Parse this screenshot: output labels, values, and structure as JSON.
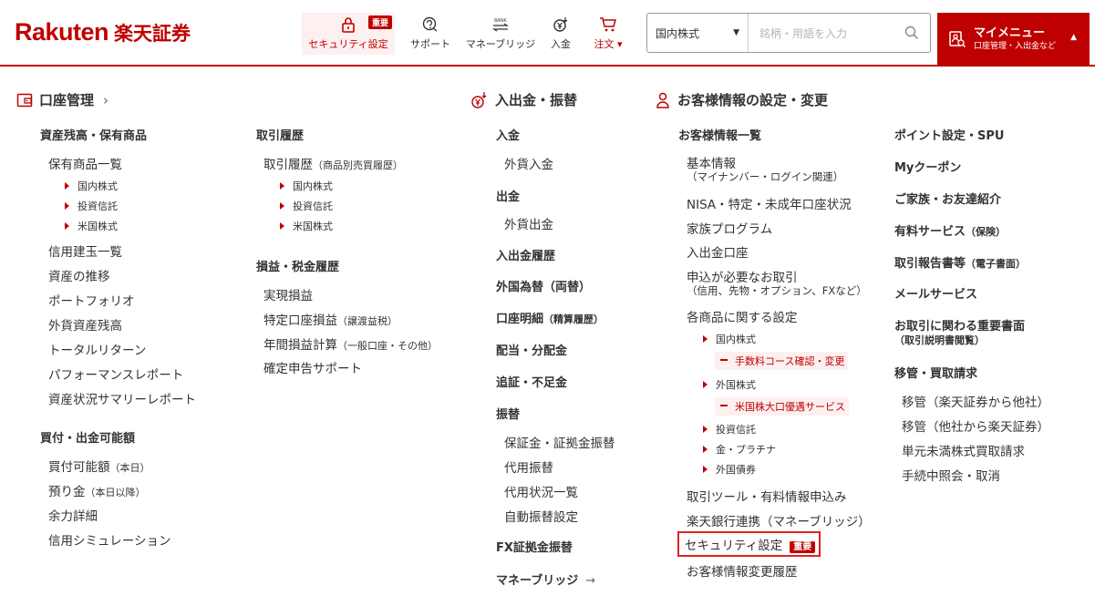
{
  "logo": {
    "en": "Rakuten",
    "jp": "楽天証券"
  },
  "nav": {
    "security": {
      "label": "セキュリティ設定",
      "badge": "重要"
    },
    "support": {
      "label": "サポート"
    },
    "money_bridge": {
      "label": "マネーブリッジ",
      "icon_text": "BANK"
    },
    "deposit": {
      "label": "入金"
    },
    "order": {
      "label": "注文 ▾"
    }
  },
  "search": {
    "category": "国内株式",
    "placeholder": "銘柄・用語を入力"
  },
  "mymenu": {
    "title": "マイメニュー",
    "subtitle": "口座管理・入出金など",
    "caret": "▲"
  },
  "sections": {
    "account": {
      "title": "口座管理",
      "chevron": "›"
    },
    "cash": {
      "title": "入出金・振替"
    },
    "customer": {
      "title": "お客様情報の設定・変更"
    }
  },
  "col1": {
    "h_assets": "資産残高・保有商品",
    "holdings": "保有商品一覧",
    "holdings_sub": [
      "国内株式",
      "投資信託",
      "米国株式"
    ],
    "margin": "信用建玉一覧",
    "asset_trend": "資産の推移",
    "portfolio": "ポートフォリオ",
    "fx_assets": "外貨資産残高",
    "total_return": "トータルリターン",
    "performance": "パフォーマンスレポート",
    "asset_summary": "資産状況サマリーレポート",
    "h_buying": "買付・出金可能額",
    "buying_power": "買付可能額",
    "buying_power_note": "（本日）",
    "deposits": "預り金",
    "deposits_note": "（本日以降）",
    "surplus": "余力詳細",
    "margin_sim": "信用シミュレーション"
  },
  "col2": {
    "h_history": "取引履歴",
    "history": "取引履歴",
    "history_note": "（商品別売買履歴）",
    "history_sub": [
      "国内株式",
      "投資信託",
      "米国株式"
    ],
    "h_pl": "損益・税金履歴",
    "realized": "実現損益",
    "specific_pl": "特定口座損益",
    "specific_pl_note": "（譲渡益税）",
    "annual_pl": "年間損益計算",
    "annual_pl_note": "（一般口座・その他）",
    "tax_support": "確定申告サポート"
  },
  "col3": {
    "h_deposit": "入金",
    "fx_deposit": "外貨入金",
    "h_withdraw": "出金",
    "fx_withdraw": "外貨出金",
    "h_history": "入出金履歴",
    "h_fx": "外国為替",
    "h_fx_note": "（両替）",
    "h_statement": "口座明細",
    "h_statement_note": "（精算履歴）",
    "h_dividend": "配当・分配金",
    "h_margin_call": "追証・不足金",
    "h_transfer": "振替",
    "transfer_items": [
      "保証金・証拠金振替",
      "代用振替",
      "代用状況一覧",
      "自動振替設定"
    ],
    "h_fx_margin": "FX証拠金振替",
    "money_bridge": "マネーブリッジ",
    "money_bridge_arrow": "→"
  },
  "col4": {
    "h_info": "お客様情報一覧",
    "basic": "基本情報",
    "basic_note": "（マイナンバー・ログイン関連）",
    "nisa": "NISA・特定・未成年口座状況",
    "family": "家族プログラム",
    "bank_account": "入出金口座",
    "apply": "申込が必要なお取引",
    "apply_note": "（信用、先物・オプション、FXなど）",
    "product_settings": "各商品に関する設定",
    "domestic": "国内株式",
    "fee_course": "手数料コース確認・変更",
    "foreign": "外国株式",
    "us_large": "米国株大口優遇サービス",
    "fund": "投資信託",
    "gold": "金・プラチナ",
    "foreign_bond": "外国債券",
    "tools": "取引ツール・有料情報申込み",
    "bank_link": "楽天銀行連携（マネーブリッジ）",
    "security": "セキュリティ設定",
    "security_badge": "重要",
    "change_history": "お客様情報変更履歴"
  },
  "col5": {
    "points": "ポイント設定・SPU",
    "coupon": "Myクーポン",
    "referral": "ご家族・お友達紹介",
    "paid": "有料サービス",
    "paid_note": "（保険）",
    "reports": "取引報告書等",
    "reports_note": "（電子書面）",
    "mail": "メールサービス",
    "important_docs": "お取引に関わる重要書面",
    "important_docs_note": "（取引説明書閲覧）",
    "h_transfer": "移管・買取請求",
    "transfer_out": "移管（楽天証券から他社）",
    "transfer_in": "移管（他社から楽天証券）",
    "odd_lot": "単元未満株式買取請求",
    "procedures": "手続中照会・取消"
  },
  "colors": {
    "brand": "#bf0000",
    "highlight_bg": "#fdf0f0",
    "border_highlight": "#e02222"
  }
}
